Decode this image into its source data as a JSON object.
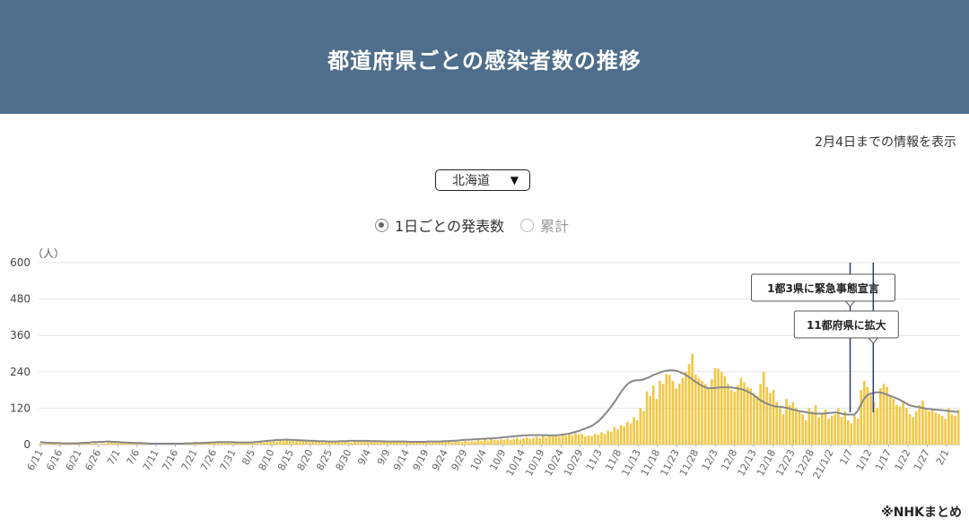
{
  "header": {
    "title": "都道府県ごとの感染者数の推移"
  },
  "info": {
    "updated_text": "2月4日までの情報を表示"
  },
  "selector": {
    "selected": "北海道"
  },
  "mode": {
    "daily_label": "1日ごとの発表数",
    "cumulative_label": "累計",
    "selected": "daily"
  },
  "footer": {
    "source": "※NHKまとめ"
  },
  "chart_data": {
    "type": "bar",
    "unit_label": "（人）",
    "ylim": [
      0,
      600
    ],
    "yticks": [
      0,
      120,
      240,
      360,
      480,
      600
    ],
    "grid": true,
    "x_start": "6/11",
    "x_end": "2/4",
    "xtick_labels": [
      "6/11",
      "6/16",
      "6/21",
      "6/26",
      "7/1",
      "7/6",
      "7/11",
      "7/16",
      "7/21",
      "7/26",
      "7/31",
      "8/5",
      "8/10",
      "8/15",
      "8/20",
      "8/25",
      "8/30",
      "9/4",
      "9/9",
      "9/14",
      "9/19",
      "9/24",
      "9/29",
      "10/4",
      "10/9",
      "10/14",
      "10/19",
      "10/24",
      "10/29",
      "11/3",
      "11/8",
      "11/13",
      "11/18",
      "11/23",
      "11/28",
      "12/3",
      "12/8",
      "12/13",
      "12/18",
      "12/23",
      "12/28",
      "21/1/2",
      "1/7",
      "1/12",
      "1/17",
      "1/22",
      "1/27",
      "2/1"
    ],
    "series": [
      {
        "kind": "bar",
        "color": "#f2c744",
        "values": [
          4,
          3,
          2,
          5,
          3,
          2,
          4,
          1,
          3,
          2,
          5,
          4,
          3,
          2,
          6,
          4,
          3,
          5,
          2,
          4,
          3,
          12,
          10,
          8,
          6,
          9,
          7,
          5,
          8,
          6,
          4,
          3,
          5,
          2,
          4,
          3,
          1,
          2,
          3,
          1,
          3,
          2,
          4,
          2,
          5,
          3,
          2,
          4,
          3,
          6,
          4,
          7,
          5,
          9,
          6,
          8,
          7,
          10,
          8,
          6,
          9,
          7,
          5,
          8,
          6,
          4,
          7,
          5,
          9,
          6,
          12,
          9,
          15,
          10,
          18,
          12,
          20,
          16,
          14,
          18,
          15,
          12,
          16,
          13,
          10,
          14,
          11,
          9,
          13,
          10,
          8,
          12,
          9,
          7,
          11,
          8,
          6,
          14,
          10,
          12,
          9,
          13,
          11,
          15,
          12,
          10,
          14,
          11,
          9,
          13,
          10,
          8,
          12,
          9,
          11,
          7,
          10,
          12,
          8,
          11,
          9,
          7,
          10,
          8,
          12,
          9,
          11,
          7,
          13,
          10,
          8,
          12,
          9,
          11,
          10,
          14,
          12,
          16,
          13,
          18,
          15,
          14,
          17,
          16,
          19,
          15,
          18,
          22,
          17,
          20,
          24,
          19,
          22,
          26,
          21,
          28,
          24,
          30,
          27,
          32,
          25,
          34,
          29,
          36,
          31,
          38,
          33,
          35,
          27,
          30,
          28,
          36,
          32,
          40,
          35,
          46,
          42,
          58,
          50,
          64,
          60,
          75,
          70,
          90,
          80,
          120,
          110,
          175,
          160,
          195,
          150,
          210,
          200,
          232,
          230,
          210,
          185,
          200,
          220,
          240,
          265,
          300,
          230,
          220,
          210,
          200,
          185,
          215,
          252,
          250,
          240,
          225,
          200,
          180,
          175,
          195,
          220,
          205,
          190,
          185,
          170,
          160,
          200,
          240,
          190,
          170,
          180,
          140,
          120,
          100,
          150,
          130,
          140,
          120,
          110,
          100,
          80,
          120,
          110,
          130,
          90,
          105,
          115,
          85,
          95,
          100,
          120,
          90,
          110,
          80,
          70,
          95,
          85,
          180,
          210,
          190,
          165,
          140,
          120,
          185,
          200,
          190,
          160,
          150,
          130,
          125,
          140,
          120,
          100,
          90,
          110,
          130,
          145,
          120,
          110,
          115,
          105,
          100,
          95,
          85,
          120,
          100,
          95,
          115
        ]
      },
      {
        "kind": "line",
        "color": "#888888",
        "name": "",
        "values": [
          8,
          7,
          6,
          6,
          5,
          5,
          5,
          4,
          4,
          4,
          4,
          4,
          4,
          5,
          6,
          6,
          7,
          8,
          8,
          9,
          9,
          10,
          10,
          9,
          9,
          8,
          7,
          7,
          6,
          6,
          5,
          5,
          5,
          4,
          4,
          3,
          3,
          3,
          3,
          3,
          3,
          3,
          3,
          3,
          3,
          3,
          4,
          4,
          4,
          5,
          5,
          5,
          6,
          6,
          7,
          7,
          8,
          8,
          8,
          8,
          8,
          8,
          7,
          7,
          7,
          7,
          7,
          7,
          8,
          9,
          10,
          11,
          12,
          13,
          14,
          15,
          15,
          16,
          16,
          16,
          15,
          15,
          14,
          14,
          13,
          13,
          12,
          12,
          11,
          11,
          11,
          10,
          10,
          10,
          10,
          11,
          11,
          11,
          12,
          12,
          12,
          12,
          12,
          12,
          12,
          11,
          11,
          11,
          11,
          10,
          10,
          10,
          10,
          10,
          10,
          10,
          10,
          9,
          9,
          9,
          9,
          9,
          9,
          10,
          10,
          10,
          10,
          10,
          11,
          11,
          12,
          12,
          13,
          14,
          15,
          16,
          16,
          17,
          17,
          18,
          19,
          19,
          20,
          20,
          21,
          22,
          23,
          24,
          25,
          26,
          27,
          28,
          29,
          30,
          30,
          31,
          31,
          31,
          31,
          31,
          31,
          30,
          30,
          30,
          31,
          32,
          33,
          35,
          37,
          40,
          43,
          46,
          50,
          54,
          58,
          63,
          70,
          78,
          88,
          100,
          112,
          126,
          140,
          156,
          172,
          186,
          198,
          206,
          210,
          212,
          212,
          214,
          218,
          222,
          228,
          232,
          236,
          240,
          243,
          244,
          245,
          244,
          242,
          238,
          233,
          227,
          220,
          212,
          205,
          198,
          192,
          188,
          186,
          186,
          187,
          188,
          189,
          189,
          189,
          188,
          187,
          185,
          183,
          180,
          176,
          170,
          164,
          156,
          148,
          142,
          136,
          132,
          128,
          126,
          125,
          124,
          122,
          120,
          117,
          114,
          112,
          110,
          108,
          106,
          104,
          103,
          102,
          102,
          102,
          103,
          104,
          105,
          106,
          104,
          102,
          100,
          99,
          99,
          98,
          110,
          130,
          150,
          162,
          168,
          170,
          172,
          172,
          170,
          166,
          162,
          158,
          154,
          150,
          144,
          138,
          132,
          128,
          126,
          124,
          122,
          120,
          118,
          117,
          116,
          115,
          114,
          113,
          112,
          110,
          110,
          108,
          108
        ]
      }
    ],
    "annotations": [
      {
        "date": "1/7",
        "label": "1都3県に緊急事態宣言"
      },
      {
        "date": "1/13",
        "label": "11都府県に拡大"
      }
    ]
  }
}
